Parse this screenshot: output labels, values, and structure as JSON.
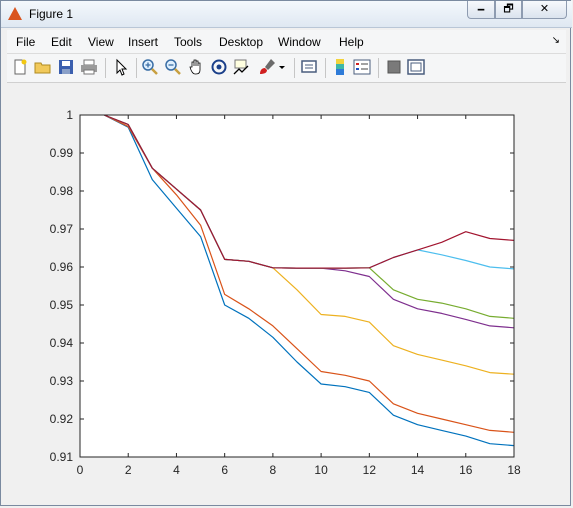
{
  "window": {
    "title": "Figure 1",
    "min_glyph": "🗕",
    "max_glyph": "🗗",
    "close_glyph": "✕"
  },
  "menubar": {
    "items": [
      "File",
      "Edit",
      "View",
      "Insert",
      "Tools",
      "Desktop",
      "Window",
      "Help"
    ],
    "dock_glyph": "↘"
  },
  "toolbar": {
    "icons": [
      "new-figure-icon",
      "open-file-icon",
      "save-icon",
      "print-icon",
      "edit-plot-icon",
      "zoom-in-icon",
      "zoom-out-icon",
      "pan-icon",
      "rotate-3d-icon",
      "data-cursor-icon",
      "brush-icon",
      "link-plot-icon",
      "colorbar-icon",
      "legend-icon",
      "hide-plot-tools-icon",
      "show-plot-tools-icon"
    ]
  },
  "chart_data": {
    "type": "line",
    "xlim": [
      0,
      18
    ],
    "ylim": [
      0.91,
      1
    ],
    "xticks": [
      "0",
      "2",
      "4",
      "6",
      "8",
      "10",
      "12",
      "14",
      "16",
      "18"
    ],
    "yticks": [
      "0.91",
      "0.92",
      "0.93",
      "0.94",
      "0.95",
      "0.96",
      "0.97",
      "0.98",
      "0.99",
      "1"
    ],
    "grid": false,
    "x": [
      1,
      2,
      3,
      4,
      5,
      6,
      7,
      8,
      9,
      10,
      11,
      12,
      13,
      14,
      15,
      16,
      17,
      18
    ],
    "series": [
      {
        "color": "#0072bd",
        "values": [
          1.0,
          0.9968,
          0.983,
          0.9755,
          0.968,
          0.95,
          0.9465,
          0.9415,
          0.935,
          0.9292,
          0.9285,
          0.927,
          0.921,
          0.9185,
          0.917,
          0.9155,
          0.9135,
          0.913
        ]
      },
      {
        "color": "#d95319",
        "values": [
          1.0,
          0.997,
          0.986,
          0.979,
          0.971,
          0.9528,
          0.949,
          0.9445,
          0.9385,
          0.9325,
          0.9315,
          0.93,
          0.924,
          0.9215,
          0.92,
          0.9185,
          0.917,
          0.9165
        ]
      },
      {
        "color": "#edb120",
        "values": [
          1.0,
          0.9975,
          0.986,
          0.9805,
          0.975,
          0.962,
          0.9615,
          0.9598,
          0.954,
          0.9475,
          0.947,
          0.9455,
          0.9393,
          0.937,
          0.9355,
          0.934,
          0.9322,
          0.9318
        ]
      },
      {
        "color": "#7e2f8e",
        "values": [
          1.0,
          0.9975,
          0.986,
          0.9805,
          0.975,
          0.962,
          0.9615,
          0.9598,
          0.9597,
          0.9597,
          0.959,
          0.9575,
          0.9515,
          0.949,
          0.9478,
          0.9462,
          0.9445,
          0.944
        ]
      },
      {
        "color": "#77ac30",
        "values": [
          1.0,
          0.9975,
          0.986,
          0.9805,
          0.975,
          0.962,
          0.9615,
          0.9598,
          0.9597,
          0.9597,
          0.9597,
          0.9598,
          0.954,
          0.9515,
          0.9505,
          0.949,
          0.947,
          0.9465
        ]
      },
      {
        "color": "#4dbeee",
        "values": [
          1.0,
          0.9975,
          0.986,
          0.9805,
          0.975,
          0.962,
          0.9615,
          0.9598,
          0.9597,
          0.9597,
          0.9597,
          0.9598,
          0.9625,
          0.9645,
          0.9632,
          0.9617,
          0.96,
          0.9595
        ]
      },
      {
        "color": "#a2142f",
        "values": [
          1.0,
          0.9975,
          0.986,
          0.9805,
          0.975,
          0.962,
          0.9615,
          0.9598,
          0.9597,
          0.9597,
          0.9597,
          0.9598,
          0.9625,
          0.9645,
          0.9665,
          0.9693,
          0.9675,
          0.967
        ]
      }
    ]
  }
}
